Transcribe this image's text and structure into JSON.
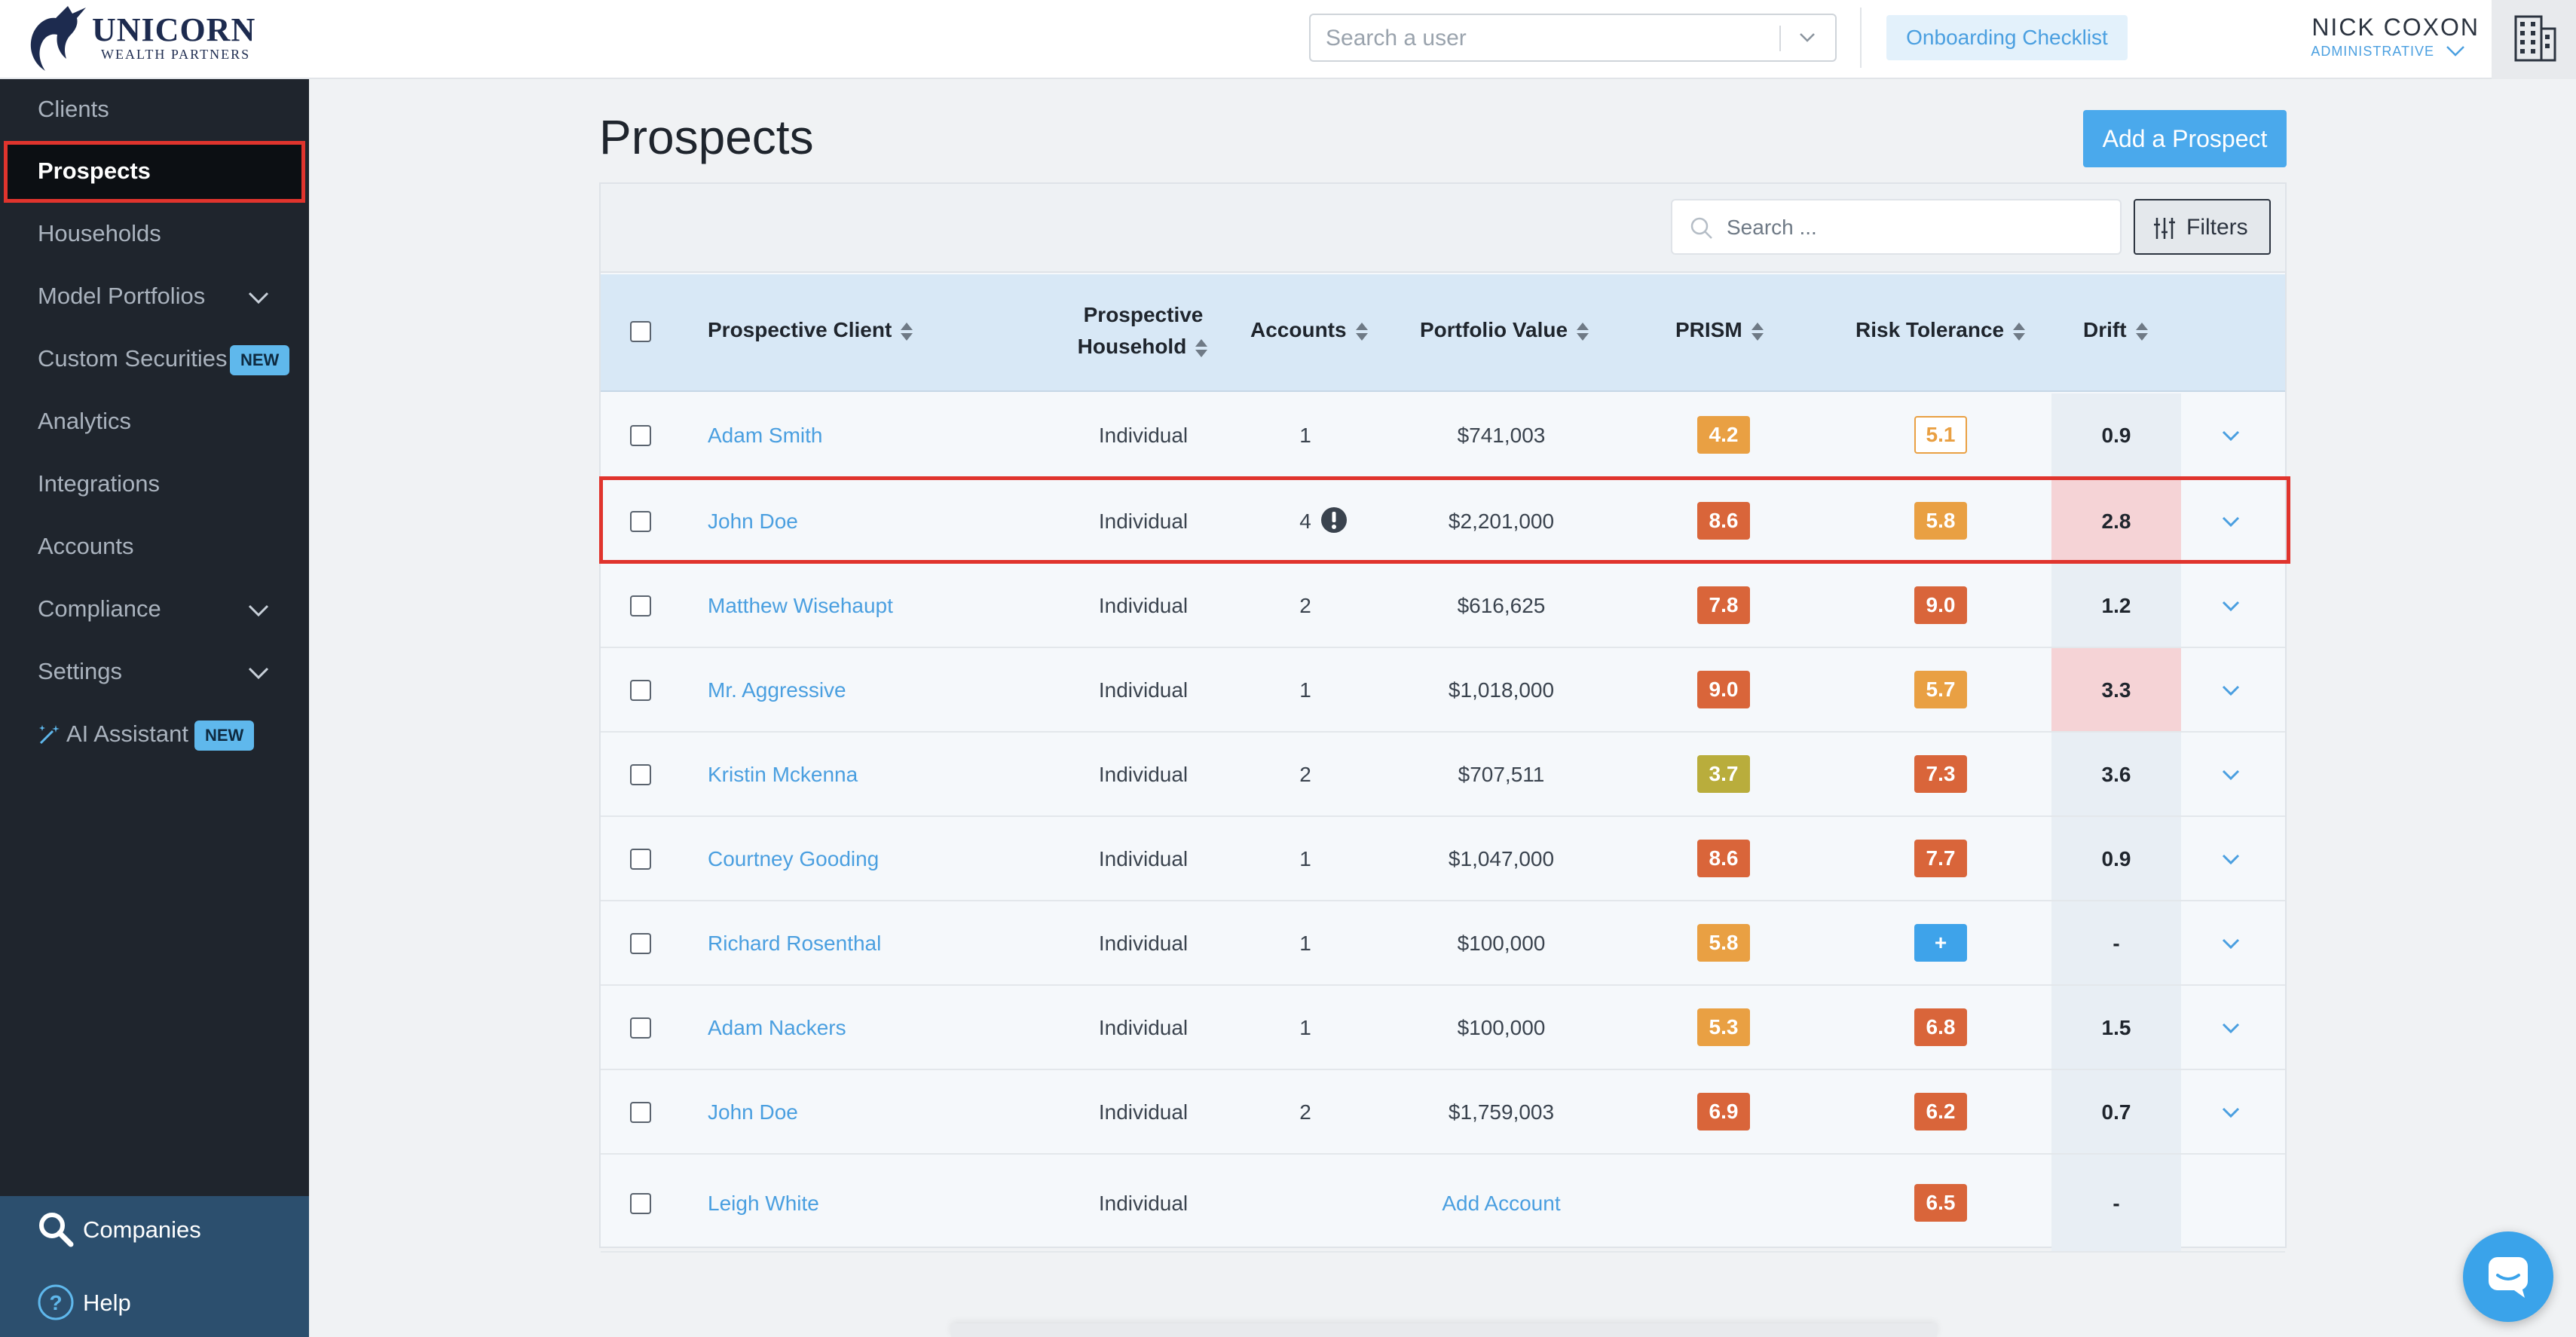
{
  "brand": {
    "name": "UNICORN",
    "sub": "WEALTH PARTNERS"
  },
  "header": {
    "user_search_placeholder": "Search a user",
    "onboarding_label": "Onboarding Checklist",
    "user_name": "NICK COXON",
    "user_role": "ADMINISTRATIVE"
  },
  "sidebar": {
    "items": [
      {
        "label": "Clients"
      },
      {
        "label": "Prospects"
      },
      {
        "label": "Households"
      },
      {
        "label": "Model Portfolios"
      },
      {
        "label": "Custom Securities",
        "badge": "NEW"
      },
      {
        "label": "Analytics"
      },
      {
        "label": "Integrations"
      },
      {
        "label": "Accounts"
      },
      {
        "label": "Compliance"
      },
      {
        "label": "Settings"
      },
      {
        "label": "AI Assistant",
        "badge": "NEW"
      }
    ],
    "bottom": [
      {
        "label": "Companies"
      },
      {
        "label": "Help"
      }
    ]
  },
  "main": {
    "title": "Prospects",
    "add_button": "Add a Prospect",
    "search_placeholder": "Search ...",
    "filters_label": "Filters",
    "columns": {
      "client": "Prospective Client",
      "household_1": "Prospective",
      "household_2": "Household",
      "accounts": "Accounts",
      "value": "Portfolio Value",
      "prism": "PRISM",
      "risk": "Risk Tolerance",
      "drift": "Drift"
    },
    "rows": [
      {
        "name": "Adam Smith",
        "household": "Individual",
        "accounts": "1",
        "value": "$741,003",
        "prism": "4.2",
        "risk": "5.1",
        "drift": "0.9"
      },
      {
        "name": "John Doe",
        "household": "Individual",
        "accounts": "4",
        "value": "$2,201,000",
        "prism": "8.6",
        "risk": "5.8",
        "drift": "2.8"
      },
      {
        "name": "Matthew Wisehaupt",
        "household": "Individual",
        "accounts": "2",
        "value": "$616,625",
        "prism": "7.8",
        "risk": "9.0",
        "drift": "1.2"
      },
      {
        "name": "Mr. Aggressive",
        "household": "Individual",
        "accounts": "1",
        "value": "$1,018,000",
        "prism": "9.0",
        "risk": "5.7",
        "drift": "3.3"
      },
      {
        "name": "Kristin Mckenna",
        "household": "Individual",
        "accounts": "2",
        "value": "$707,511",
        "prism": "3.7",
        "risk": "7.3",
        "drift": "3.6"
      },
      {
        "name": "Courtney Gooding",
        "household": "Individual",
        "accounts": "1",
        "value": "$1,047,000",
        "prism": "8.6",
        "risk": "7.7",
        "drift": "0.9"
      },
      {
        "name": "Richard Rosenthal",
        "household": "Individual",
        "accounts": "1",
        "value": "$100,000",
        "prism": "5.8",
        "risk": "+",
        "drift": "-"
      },
      {
        "name": "Adam Nackers",
        "household": "Individual",
        "accounts": "1",
        "value": "$100,000",
        "prism": "5.3",
        "risk": "6.8",
        "drift": "1.5"
      },
      {
        "name": "John Doe",
        "household": "Individual",
        "accounts": "2",
        "value": "$1,759,003",
        "prism": "6.9",
        "risk": "6.2",
        "drift": "0.7"
      },
      {
        "name": "Leigh White",
        "household": "Individual",
        "accounts": "",
        "value": "Add Account",
        "prism": "",
        "risk": "6.5",
        "drift": "-"
      }
    ]
  },
  "colors": {
    "orange": "#e9a043",
    "red_orange": "#d9653a",
    "olive": "#b9ad3c",
    "blue": "#3ea3ea",
    "drift_warn": "#f5d3d6",
    "accent": "#4aa9ec"
  }
}
